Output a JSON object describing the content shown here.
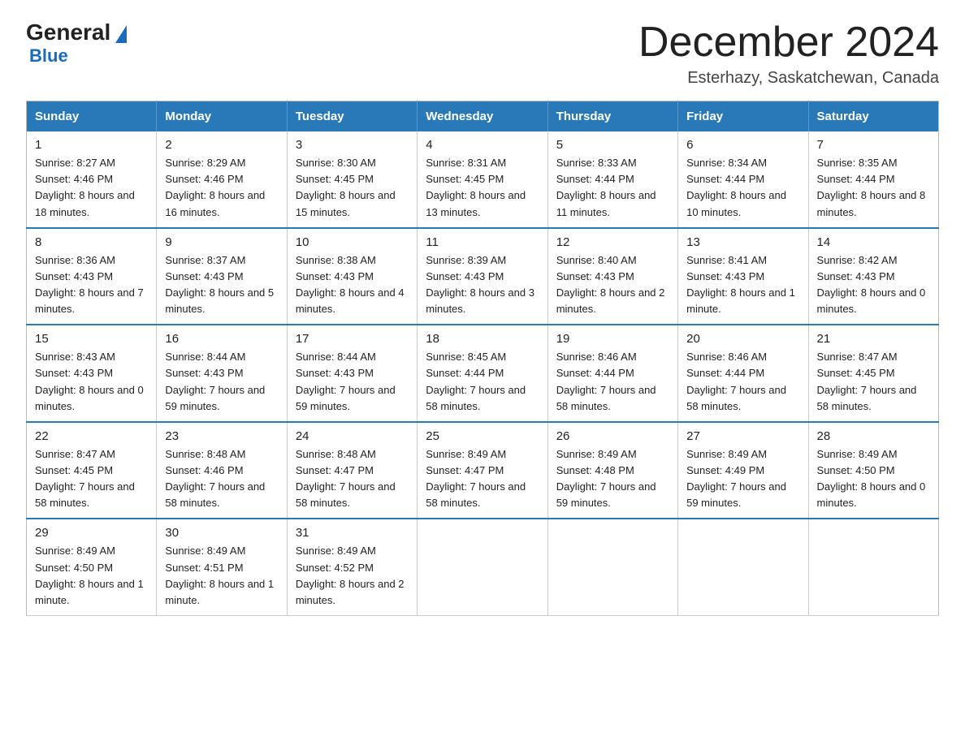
{
  "logo": {
    "general": "General",
    "blue": "Blue"
  },
  "title": "December 2024",
  "location": "Esterhazy, Saskatchewan, Canada",
  "days_of_week": [
    "Sunday",
    "Monday",
    "Tuesday",
    "Wednesday",
    "Thursday",
    "Friday",
    "Saturday"
  ],
  "weeks": [
    [
      {
        "day": "1",
        "sunrise": "Sunrise: 8:27 AM",
        "sunset": "Sunset: 4:46 PM",
        "daylight": "Daylight: 8 hours and 18 minutes."
      },
      {
        "day": "2",
        "sunrise": "Sunrise: 8:29 AM",
        "sunset": "Sunset: 4:46 PM",
        "daylight": "Daylight: 8 hours and 16 minutes."
      },
      {
        "day": "3",
        "sunrise": "Sunrise: 8:30 AM",
        "sunset": "Sunset: 4:45 PM",
        "daylight": "Daylight: 8 hours and 15 minutes."
      },
      {
        "day": "4",
        "sunrise": "Sunrise: 8:31 AM",
        "sunset": "Sunset: 4:45 PM",
        "daylight": "Daylight: 8 hours and 13 minutes."
      },
      {
        "day": "5",
        "sunrise": "Sunrise: 8:33 AM",
        "sunset": "Sunset: 4:44 PM",
        "daylight": "Daylight: 8 hours and 11 minutes."
      },
      {
        "day": "6",
        "sunrise": "Sunrise: 8:34 AM",
        "sunset": "Sunset: 4:44 PM",
        "daylight": "Daylight: 8 hours and 10 minutes."
      },
      {
        "day": "7",
        "sunrise": "Sunrise: 8:35 AM",
        "sunset": "Sunset: 4:44 PM",
        "daylight": "Daylight: 8 hours and 8 minutes."
      }
    ],
    [
      {
        "day": "8",
        "sunrise": "Sunrise: 8:36 AM",
        "sunset": "Sunset: 4:43 PM",
        "daylight": "Daylight: 8 hours and 7 minutes."
      },
      {
        "day": "9",
        "sunrise": "Sunrise: 8:37 AM",
        "sunset": "Sunset: 4:43 PM",
        "daylight": "Daylight: 8 hours and 5 minutes."
      },
      {
        "day": "10",
        "sunrise": "Sunrise: 8:38 AM",
        "sunset": "Sunset: 4:43 PM",
        "daylight": "Daylight: 8 hours and 4 minutes."
      },
      {
        "day": "11",
        "sunrise": "Sunrise: 8:39 AM",
        "sunset": "Sunset: 4:43 PM",
        "daylight": "Daylight: 8 hours and 3 minutes."
      },
      {
        "day": "12",
        "sunrise": "Sunrise: 8:40 AM",
        "sunset": "Sunset: 4:43 PM",
        "daylight": "Daylight: 8 hours and 2 minutes."
      },
      {
        "day": "13",
        "sunrise": "Sunrise: 8:41 AM",
        "sunset": "Sunset: 4:43 PM",
        "daylight": "Daylight: 8 hours and 1 minute."
      },
      {
        "day": "14",
        "sunrise": "Sunrise: 8:42 AM",
        "sunset": "Sunset: 4:43 PM",
        "daylight": "Daylight: 8 hours and 0 minutes."
      }
    ],
    [
      {
        "day": "15",
        "sunrise": "Sunrise: 8:43 AM",
        "sunset": "Sunset: 4:43 PM",
        "daylight": "Daylight: 8 hours and 0 minutes."
      },
      {
        "day": "16",
        "sunrise": "Sunrise: 8:44 AM",
        "sunset": "Sunset: 4:43 PM",
        "daylight": "Daylight: 7 hours and 59 minutes."
      },
      {
        "day": "17",
        "sunrise": "Sunrise: 8:44 AM",
        "sunset": "Sunset: 4:43 PM",
        "daylight": "Daylight: 7 hours and 59 minutes."
      },
      {
        "day": "18",
        "sunrise": "Sunrise: 8:45 AM",
        "sunset": "Sunset: 4:44 PM",
        "daylight": "Daylight: 7 hours and 58 minutes."
      },
      {
        "day": "19",
        "sunrise": "Sunrise: 8:46 AM",
        "sunset": "Sunset: 4:44 PM",
        "daylight": "Daylight: 7 hours and 58 minutes."
      },
      {
        "day": "20",
        "sunrise": "Sunrise: 8:46 AM",
        "sunset": "Sunset: 4:44 PM",
        "daylight": "Daylight: 7 hours and 58 minutes."
      },
      {
        "day": "21",
        "sunrise": "Sunrise: 8:47 AM",
        "sunset": "Sunset: 4:45 PM",
        "daylight": "Daylight: 7 hours and 58 minutes."
      }
    ],
    [
      {
        "day": "22",
        "sunrise": "Sunrise: 8:47 AM",
        "sunset": "Sunset: 4:45 PM",
        "daylight": "Daylight: 7 hours and 58 minutes."
      },
      {
        "day": "23",
        "sunrise": "Sunrise: 8:48 AM",
        "sunset": "Sunset: 4:46 PM",
        "daylight": "Daylight: 7 hours and 58 minutes."
      },
      {
        "day": "24",
        "sunrise": "Sunrise: 8:48 AM",
        "sunset": "Sunset: 4:47 PM",
        "daylight": "Daylight: 7 hours and 58 minutes."
      },
      {
        "day": "25",
        "sunrise": "Sunrise: 8:49 AM",
        "sunset": "Sunset: 4:47 PM",
        "daylight": "Daylight: 7 hours and 58 minutes."
      },
      {
        "day": "26",
        "sunrise": "Sunrise: 8:49 AM",
        "sunset": "Sunset: 4:48 PM",
        "daylight": "Daylight: 7 hours and 59 minutes."
      },
      {
        "day": "27",
        "sunrise": "Sunrise: 8:49 AM",
        "sunset": "Sunset: 4:49 PM",
        "daylight": "Daylight: 7 hours and 59 minutes."
      },
      {
        "day": "28",
        "sunrise": "Sunrise: 8:49 AM",
        "sunset": "Sunset: 4:50 PM",
        "daylight": "Daylight: 8 hours and 0 minutes."
      }
    ],
    [
      {
        "day": "29",
        "sunrise": "Sunrise: 8:49 AM",
        "sunset": "Sunset: 4:50 PM",
        "daylight": "Daylight: 8 hours and 1 minute."
      },
      {
        "day": "30",
        "sunrise": "Sunrise: 8:49 AM",
        "sunset": "Sunset: 4:51 PM",
        "daylight": "Daylight: 8 hours and 1 minute."
      },
      {
        "day": "31",
        "sunrise": "Sunrise: 8:49 AM",
        "sunset": "Sunset: 4:52 PM",
        "daylight": "Daylight: 8 hours and 2 minutes."
      },
      null,
      null,
      null,
      null
    ]
  ]
}
